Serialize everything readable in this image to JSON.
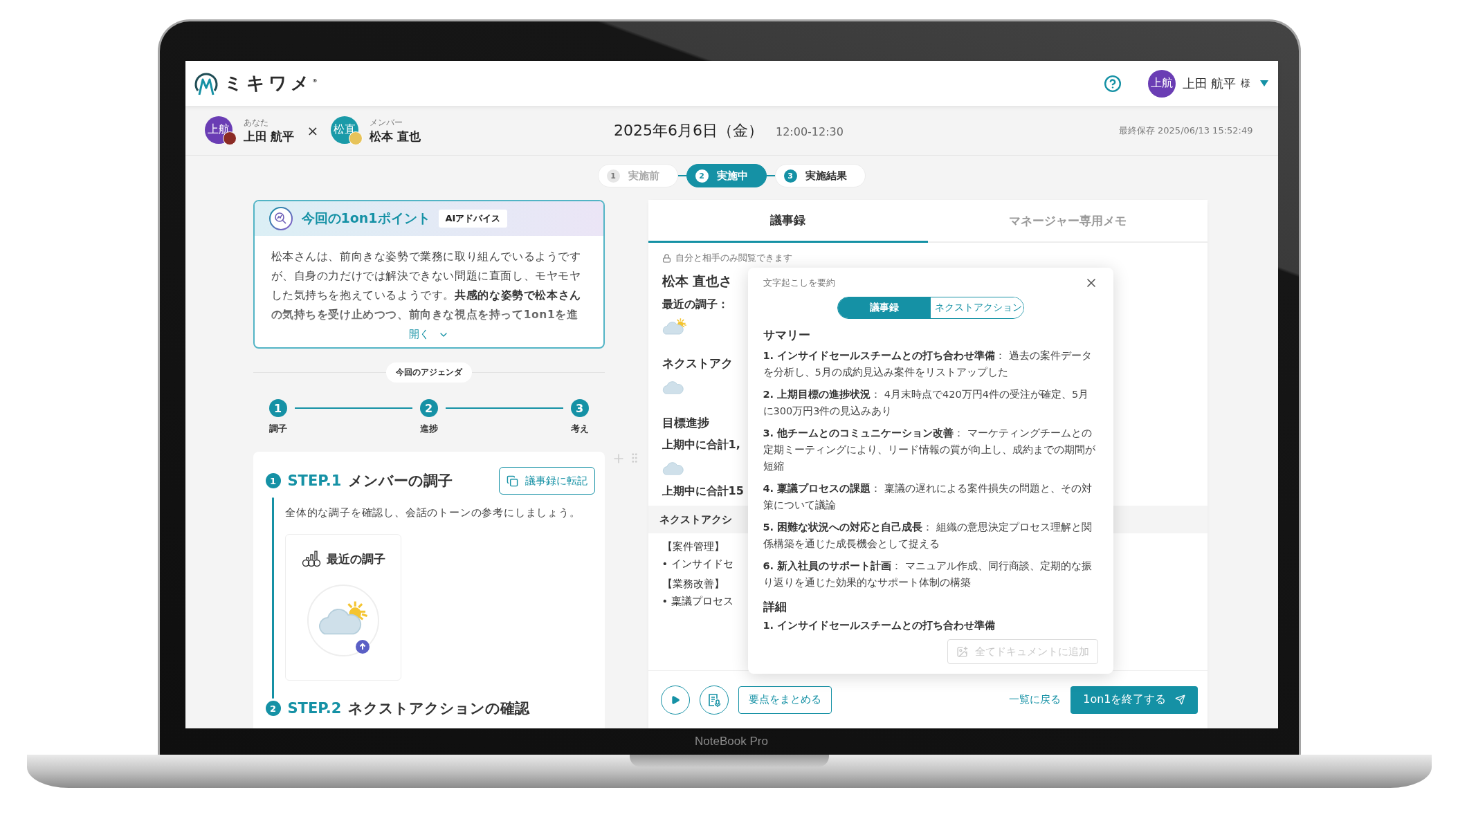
{
  "laptop": {
    "label": "NoteBook Pro"
  },
  "nav": {
    "logo": "ミキワメ$^{®}$",
    "user": {
      "avatar": "上航",
      "name": "上田 航平",
      "honorific": "様"
    }
  },
  "session": {
    "you": {
      "role": "あなた",
      "avatar": "上航",
      "name": "上田 航平"
    },
    "separator": "×",
    "member": {
      "role": "メンバー",
      "avatar": "松直",
      "name": "松本 直也"
    },
    "date": "2025年6月6日（金）",
    "time": "12:00-12:30",
    "saved": "最終保存 2025/06/13 15:52:49"
  },
  "phases": [
    {
      "number": "1",
      "label": "実施前",
      "selected": false,
      "disabled": true
    },
    {
      "number": "2",
      "label": "実施中",
      "selected": true,
      "disabled": false
    },
    {
      "number": "3",
      "label": "実施結果",
      "selected": false,
      "disabled": false
    }
  ],
  "ai_point": {
    "title": "今回の1on1ポイント",
    "badge": "AIアドバイス",
    "text": "松本さんは、前向きな姿勢で業務に取り組んでいるようですが、自身の力だけでは解決できない問題に直面し、モヤモヤした気持ちを抱えているようです。**共感的な姿勢で松本さんの気持ちを受け止めつつ、前向きな視点を持って1on1を進**",
    "expand": "開く"
  },
  "agenda": {
    "label": "今回のアジェンダ",
    "steps": [
      {
        "number": "1",
        "label": "調子"
      },
      {
        "number": "2",
        "label": "進捗"
      },
      {
        "number": "3",
        "label": "考え"
      }
    ]
  },
  "step_card": {
    "number": "1",
    "step": "STEP.1",
    "title": "メンバーの調子",
    "copy_button": "議事録に転記",
    "description": "全体的な調子を確認し、会話のトーンの参考にしましょう。",
    "mood": {
      "title": "最近の調子",
      "kind": "suncloud"
    },
    "next": {
      "number": "2",
      "step": "STEP.2",
      "title": "ネクストアクションの確認"
    }
  },
  "minutes": {
    "tabs": [
      {
        "label": "議事録",
        "selected": true
      },
      {
        "label": "マネージャー専用メモ",
        "selected": false
      }
    ],
    "privacy": "自分と相手のみ閲覧できます",
    "lines": [
      {
        "kind": "name",
        "text": "松本 直也さ"
      },
      {
        "kind": "heading",
        "text": "最近の調子："
      },
      {
        "kind": "suncloud"
      },
      {
        "kind": "section",
        "text": "ネクストアク"
      },
      {
        "kind": "cloud"
      },
      {
        "kind": "section",
        "text": "目標進捗"
      },
      {
        "kind": "heading",
        "text": "上期中に合計1,"
      },
      {
        "kind": "cloud"
      },
      {
        "kind": "heading",
        "text": "上期中に合計15"
      },
      {
        "kind": "band",
        "text": "ネクストアクシ"
      },
      {
        "kind": "plain",
        "text": "【案件管理】"
      },
      {
        "kind": "bullet",
        "text": "• インサイドセ"
      },
      {
        "kind": "plain",
        "text": "【業務改善】"
      },
      {
        "kind": "bullet",
        "text": "• 稟議プロセス"
      }
    ]
  },
  "summary_popup": {
    "title": "文字起こしを要約",
    "tabs": [
      {
        "label": "議事録",
        "selected": true
      },
      {
        "label": "ネクストアクション",
        "selected": false
      }
    ],
    "summary_heading": "サマリー",
    "items": [
      "**1. インサイドセールスチームとの打ち合わせ準備**： 過去の案件データを分析し、5月の成約見込み案件をリストアップした",
      "**2. 上期目標の進捗状況**： 4月末時点で420万円4件の受注が確定、5月に300万円3件の見込みあり",
      "**3. 他チームとのコミュニケーション改善**： マーケティングチームとの定期ミーティングにより、リード情報の質が向上し、成約までの期間が短縮",
      "**4. 稟議プロセスの課題**： 稟議の遅れによる案件損失の問題と、その対策について議論",
      "**5. 困難な状況への対応と自己成長**： 組織の意思決定プロセス理解と関係構築を通じた成長機会として捉える",
      "**6. 新入社員のサポート計画**： マニュアル作成、同行商談、定期的な振り返りを通じた効果的なサポート体制の構築"
    ],
    "detail_heading": "詳細",
    "detail_first": "1. インサイドセールスチームとの打ち合わせ準備",
    "add_button": {
      "label": "全てドキュメントに追加",
      "disabled": true
    }
  },
  "footer": {
    "summarize": "要点をまとめる",
    "back": "一覧に戻る",
    "finish": "1on1を終了する"
  }
}
